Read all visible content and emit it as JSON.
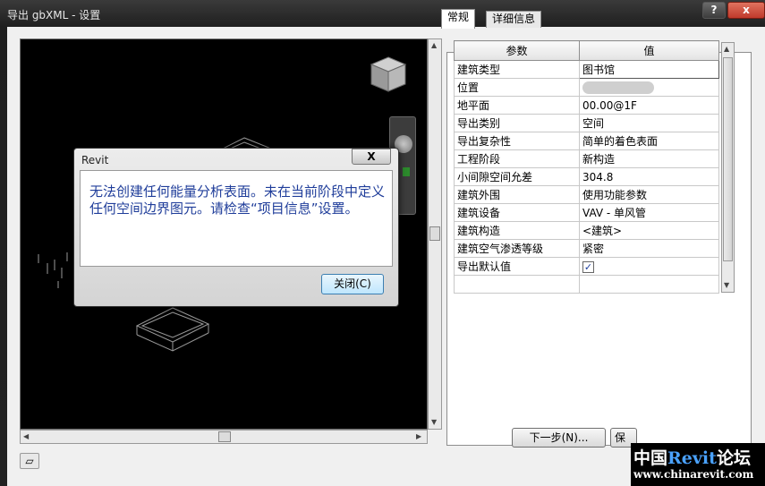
{
  "window": {
    "title": "导出 gbXML - 设置",
    "help_label": "?",
    "close_label": "x"
  },
  "tabs": [
    {
      "label": "常规"
    },
    {
      "label": "详细信息"
    }
  ],
  "grid": {
    "headers": [
      "参数",
      "值"
    ],
    "rows": [
      {
        "param": "建筑类型",
        "value": "图书馆"
      },
      {
        "param": "位置",
        "value": ""
      },
      {
        "param": "地平面",
        "value": "00.00@1F"
      },
      {
        "param": "导出类别",
        "value": "空间"
      },
      {
        "param": "导出复杂性",
        "value": "简单的着色表面"
      },
      {
        "param": "工程阶段",
        "value": "新构造"
      },
      {
        "param": "小间隙空间允差",
        "value": "304.8"
      },
      {
        "param": "建筑外围",
        "value": "使用功能参数"
      },
      {
        "param": "建筑设备",
        "value": "VAV - 单风管"
      },
      {
        "param": "建筑构造",
        "value": "<建筑>"
      },
      {
        "param": "建筑空气渗透等级",
        "value": "紧密"
      },
      {
        "param": "导出默认值",
        "value": "✓"
      }
    ]
  },
  "footer": {
    "next_label": "下一步(N)...",
    "save_label": "保"
  },
  "modal": {
    "title": "Revit",
    "close_label": "X",
    "message": "无法创建任何能量分析表面。未在当前阶段中定义任何空间边界图元。请检查“项目信息”设置。",
    "ok_label": "关闭(C)"
  },
  "watermark": {
    "line1_a": "中国",
    "line1_b": "Revit",
    "line1_c": "论坛",
    "line2": "www.chinarevit.com"
  }
}
